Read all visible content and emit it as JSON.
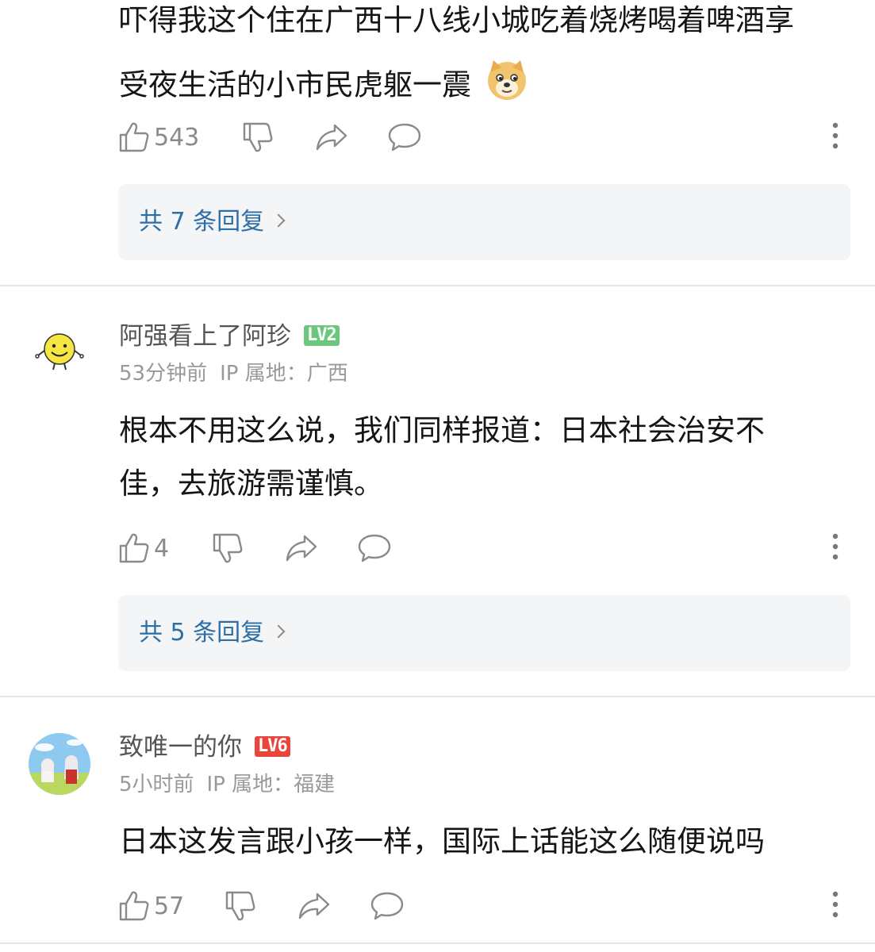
{
  "comments": [
    {
      "text_lines": [
        "吓得我这个住在广西十八线小城吃着烧烤喝着啤酒享",
        "受夜生活的小市民虎躯一震"
      ],
      "emoji": "doge-emoji",
      "likes": "543",
      "replies_label": "共 7 条回复"
    },
    {
      "username": "阿强看上了阿珍",
      "level": "LV2",
      "level_color": "#6cc67e",
      "time": "53分钟前",
      "ip_label": "IP 属地：广西",
      "text_lines": [
        "根本不用这么说，我们同样报道：日本社会治安不",
        "佳，去旅游需谨慎。"
      ],
      "likes": "4",
      "replies_label": "共 5 条回复"
    },
    {
      "username": "致唯一的你",
      "level": "LV6",
      "level_color": "#e8453c",
      "time": "5小时前",
      "ip_label": "IP 属地：福建",
      "text_lines": [
        "日本这发言跟小孩一样，国际上话能这么随便说吗"
      ],
      "likes": "57"
    }
  ],
  "icons": [
    "thumbs-up-icon",
    "thumbs-down-icon",
    "share-icon",
    "comment-icon",
    "more-icon",
    "chevron-right-icon"
  ],
  "colors": {
    "link": "#2e6ea6",
    "meta": "#999999",
    "reply_bg": "#f4f5f7"
  }
}
